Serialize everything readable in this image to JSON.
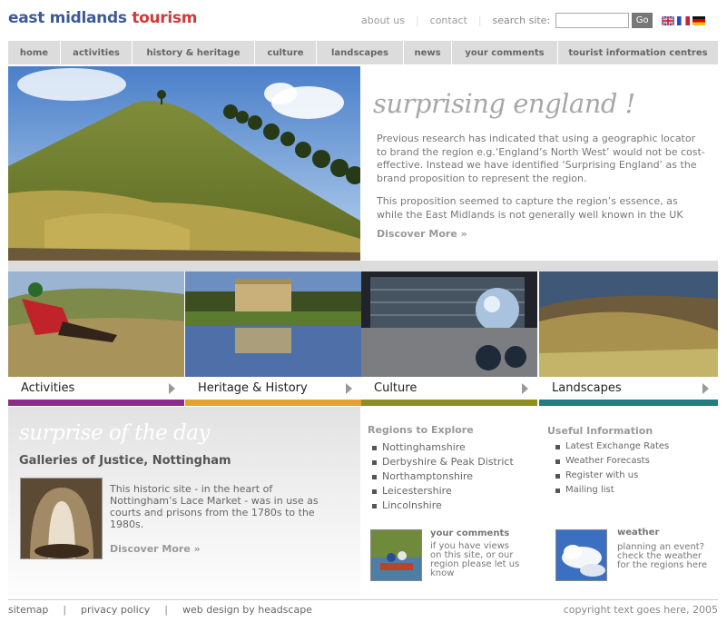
{
  "header": {
    "logo_part1": "east midlands ",
    "logo_part2": "tourism",
    "about": "about us",
    "contact": "contact",
    "search_label": "search site:",
    "search_value": "",
    "go_label": "Go"
  },
  "nav": [
    "home",
    "activities",
    "history & heritage",
    "culture",
    "landscapes",
    "news",
    "your comments",
    "tourist information centres"
  ],
  "hero": {
    "title": "surprising england !",
    "p1": "Previous research has indicated that using a geographic locator to brand the region e.g.‘England’s North West’ would not be cost-effective.  Instead we have identified ‘Surprising England’ as the brand proposition to represent the region.",
    "p2": "This proposition seemed to capture the region’s essence, as while the East Midlands is not generally well known in the UK",
    "more": "Discover More »"
  },
  "tiles": [
    {
      "label": "Activities",
      "color": "#8b2d86"
    },
    {
      "label": "Heritage & History",
      "color": "#e3a42b"
    },
    {
      "label": "Culture",
      "color": "#8c8e1f"
    },
    {
      "label": "Landscapes",
      "color": "#227d82"
    }
  ],
  "surprise": {
    "title": "surprise of the day",
    "subtitle": "Galleries of Justice, Nottingham",
    "text": "This historic site - in the heart of Nottingham’s Lace Market - was in use as courts and prisons from the 1780s to the 1980s.",
    "more": "Discover More »"
  },
  "regions": {
    "heading": "Regions to Explore",
    "items": [
      "Nottinghamshire",
      "Derbyshire & Peak District",
      "Northamptonshire",
      "Leicestershire",
      "Lincolnshire"
    ]
  },
  "useful": {
    "heading": "Useful Information",
    "items": [
      "Latest Exchange Rates",
      "Weather Forecasts",
      "Register with us",
      "Mailing list"
    ]
  },
  "comments": {
    "heading": "your comments",
    "text": "if you have views on this site, or our region please let us know"
  },
  "weather": {
    "heading": "weather",
    "text": "planning an event? check the weather for the regions here"
  },
  "footer": {
    "sitemap": "sitemap",
    "privacy": "privacy policy",
    "design": "web design by headscape",
    "copyright": "copyright text goes here,  2005"
  }
}
